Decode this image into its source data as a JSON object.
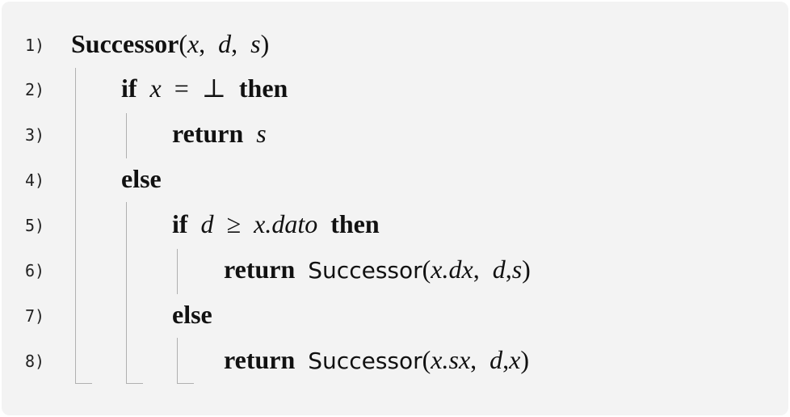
{
  "line_numbers": [
    "1)",
    "2)",
    "3)",
    "4)",
    "5)",
    "6)",
    "7)",
    "8)"
  ],
  "keywords": {
    "if": "if",
    "then": "then",
    "return": "return",
    "else": "else"
  },
  "lines": {
    "l1": {
      "name": "Successor",
      "open": "(",
      "a1": "x",
      "c1": ",",
      "a2": "d",
      "c2": ",",
      "a3": "s",
      "close": ")"
    },
    "l2": {
      "cond_lhs": "x",
      "op": "=",
      "rhs": "⊥"
    },
    "l3": {
      "val": "s"
    },
    "l5": {
      "cond_lhs": "d",
      "op": "≥",
      "rhs": "x.dato"
    },
    "l6": {
      "fn": "Successor",
      "open": "(",
      "a1": "x.dx",
      "c1": ",",
      "a2": "d",
      "c2": ",",
      "a3": "s",
      "close": ")"
    },
    "l8": {
      "fn": "Successor",
      "open": "(",
      "a1": "x.sx",
      "c1": ",",
      "a2": "d",
      "c2": ",",
      "a3": "x",
      "close": ")"
    }
  }
}
